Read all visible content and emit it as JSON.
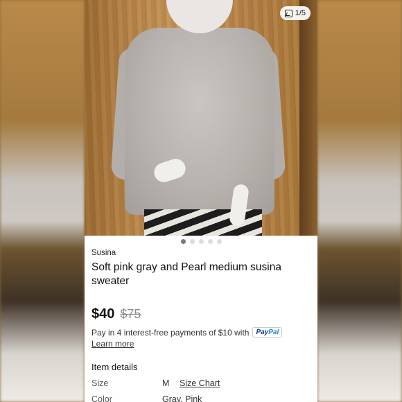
{
  "gallery": {
    "counter": "1/5",
    "counter_icon": "image-icon",
    "dots": [
      true,
      false,
      false,
      false,
      false
    ]
  },
  "listing": {
    "brand": "Susina",
    "title": "Soft pink gray and Pearl medium susina sweater",
    "price": "$40",
    "original_price": "$75"
  },
  "payment": {
    "text": "Pay in 4 interest-free payments of $10 with",
    "paypal_a": "Pay",
    "paypal_b": "Pal",
    "learn_more": "Learn more"
  },
  "details": {
    "heading": "Item details",
    "size_label": "Size",
    "size_value": "M",
    "size_chart": "Size Chart",
    "color_label": "Color",
    "color_value": "Gray, Pink"
  },
  "colors": {
    "text": "#111111",
    "muted": "#8a8a8a",
    "paypal_blue": "#1a3a8a"
  }
}
